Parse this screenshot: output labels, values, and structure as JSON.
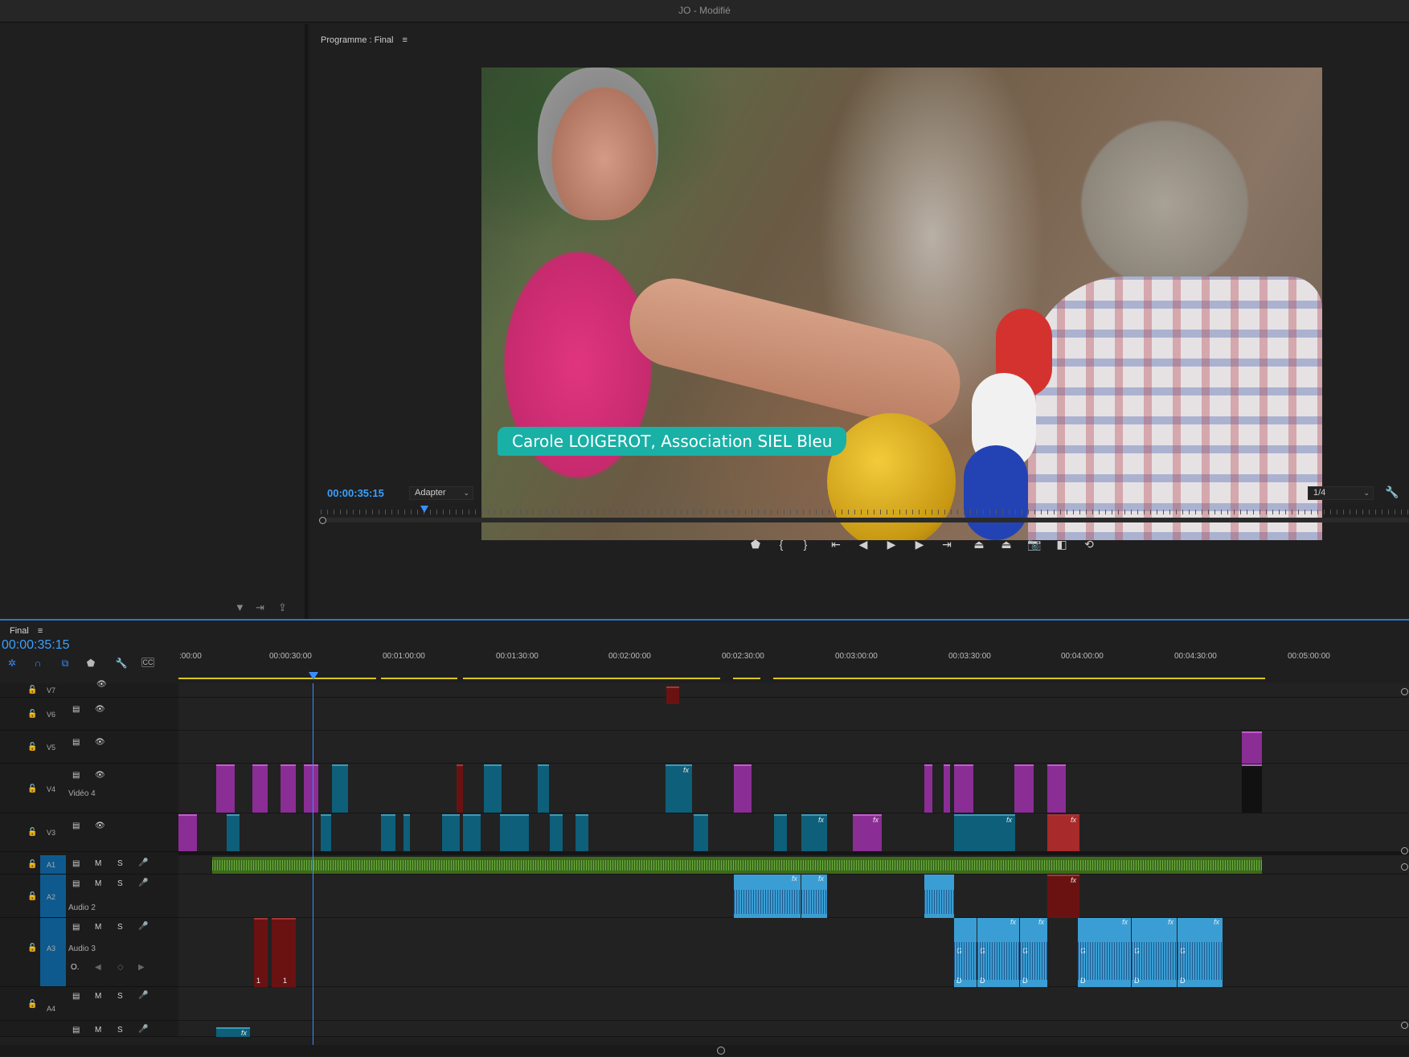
{
  "window": {
    "title": "JO",
    "status": "- Modifié"
  },
  "program_monitor": {
    "title": "Programme : Final",
    "menu_icon": "hamburger-icon",
    "lower_third": "Carole LOIGEROT, Association SIEL Bleu",
    "timecode": "00:00:35:15",
    "zoom": "Adapter",
    "resolution": "1/4",
    "playhead_fraction": 0.095,
    "transport_icons": [
      "marker-icon",
      "mark-in-icon",
      "mark-out-icon",
      "go-to-in-icon",
      "step-back-icon",
      "play-icon",
      "step-forward-icon",
      "go-to-out-icon",
      "lift-icon",
      "extract-icon",
      "export-frame-icon",
      "compare-icon",
      "multicam-icon"
    ]
  },
  "timeline": {
    "sequence_name": "Final",
    "timecode": "00:00:35:15",
    "ruler_labels": [
      ":00:00",
      "00:00:30:00",
      "00:01:00:00",
      "00:01:30:00",
      "00:02:00:00",
      "00:02:30:00",
      "00:03:00:00",
      "00:03:30:00",
      "00:04:00:00",
      "00:04:30:00",
      "00:05:00:00"
    ],
    "tools": [
      "snap-icon",
      "linked-selection-icon",
      "add-marker-icon",
      "marker-icon",
      "wrench-icon",
      "captions-icon"
    ],
    "tracks": {
      "v7": "V7",
      "v6": "V6",
      "v5": "V5",
      "v4": "V4",
      "v4_name": "Vidéo 4",
      "v3": "V3",
      "a1": "A1",
      "a2": "A2",
      "a2_name": "Audio 2",
      "a3": "A3",
      "a3_name": "Audio 3",
      "a4": "A4"
    },
    "track_buttons": {
      "mute": "M",
      "solo": "S"
    },
    "clip_labels": {
      "fx": "fx",
      "g": "G",
      "d": "D",
      "one": "1"
    }
  }
}
